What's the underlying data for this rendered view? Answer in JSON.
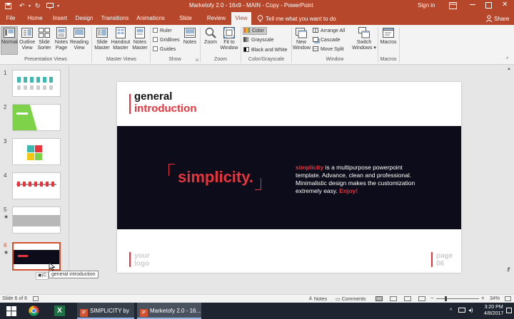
{
  "window": {
    "title": "Marketofy 2.0 - 16x9 - MAIN - Copy  -  PowerPoint",
    "sign_in": "Sign in"
  },
  "tabs": [
    "File",
    "Home",
    "Insert",
    "Design",
    "Transitions",
    "Animations",
    "Slide Show",
    "Review",
    "View"
  ],
  "active_tab": "View",
  "tell_me": "Tell me what you want to do",
  "share": "Share",
  "ribbon": {
    "presentation_views": {
      "label": "Presentation Views",
      "buttons": [
        {
          "line1": "Normal",
          "line2": ""
        },
        {
          "line1": "Outline",
          "line2": "View"
        },
        {
          "line1": "Slide",
          "line2": "Sorter"
        },
        {
          "line1": "Notes",
          "line2": "Page"
        },
        {
          "line1": "Reading",
          "line2": "View"
        }
      ]
    },
    "master_views": {
      "label": "Master Views",
      "buttons": [
        {
          "line1": "Slide",
          "line2": "Master"
        },
        {
          "line1": "Handout",
          "line2": "Master"
        },
        {
          "line1": "Notes",
          "line2": "Master"
        }
      ]
    },
    "show": {
      "label": "Show",
      "checks": [
        "Ruler",
        "Gridlines",
        "Guides"
      ],
      "notes": "Notes"
    },
    "zoom": {
      "label": "Zoom",
      "zoom_btn": "Zoom",
      "fit_line1": "Fit to",
      "fit_line2": "Window"
    },
    "color_grayscale": {
      "label": "Color/Grayscale",
      "items": [
        "Color",
        "Grayscale",
        "Black and White"
      ]
    },
    "window": {
      "label": "Window",
      "new_line1": "New",
      "new_line2": "Window",
      "items": [
        "Arrange All",
        "Cascade",
        "Move Split"
      ],
      "switch_line1": "Switch",
      "switch_line2": "Windows ▾"
    },
    "macros": {
      "label": "Macros",
      "btn": "Macros"
    }
  },
  "thumbnails": [
    {
      "num": "1",
      "star": ""
    },
    {
      "num": "2",
      "star": ""
    },
    {
      "num": "3",
      "star": ""
    },
    {
      "num": "4",
      "star": ""
    },
    {
      "num": "5",
      "star": "★"
    },
    {
      "num": "6",
      "star": "★"
    }
  ],
  "tooltip": "general introduction",
  "paste_hint": "(C",
  "slide": {
    "title_line1": "general",
    "title_line2": "introduction",
    "headline": "simplicity.",
    "body_lead": "simplicity",
    "body_rest": " is a multipurpose powerpoint template. Advance, clean and professional. Minimalistic design makes the customization extremely easy. ",
    "body_end": "Enjoy!",
    "logo_line1": "your",
    "logo_line2": "logo",
    "page_line1": "page",
    "page_line2": "06"
  },
  "status": {
    "slide_info": "Slide 6 of 6",
    "notes": "Notes",
    "comments": "Comments",
    "zoom": "34%"
  },
  "taskbar": {
    "item1": "SIMPLICITY by S...",
    "item2": "Marketofy 2.0 - 16...",
    "time": "3:20 PM",
    "date": "4/8/2017"
  },
  "colors": {
    "accent": "#b7472a",
    "brand_red": "#e8343c",
    "slide_dark": "#0d0c1a"
  }
}
